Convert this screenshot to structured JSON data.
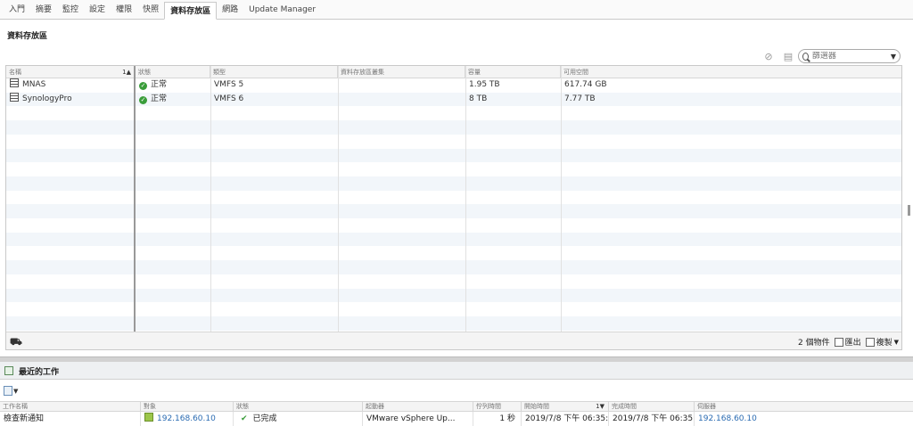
{
  "tabs": [
    "入門",
    "摘要",
    "監控",
    "設定",
    "權限",
    "快照",
    "資料存放區",
    "網路",
    "Update Manager"
  ],
  "active_tab_index": 6,
  "section_title": "資料存放區",
  "filter": {
    "placeholder": "篩選器"
  },
  "datastore_table": {
    "columns": [
      "名稱",
      "狀態",
      "類型",
      "資料存放區叢集",
      "容量",
      "可用空間"
    ],
    "sort_indicator": "1▲",
    "rows": [
      {
        "name": "MNAS",
        "status": "正常",
        "type": "VMFS 5",
        "cluster": "",
        "capacity": "1.95  TB",
        "free": "617.74  GB"
      },
      {
        "name": "SynologyPro",
        "status": "正常",
        "type": "VMFS 6",
        "cluster": "",
        "capacity": "8  TB",
        "free": "7.77  TB"
      }
    ],
    "footer": {
      "count": "2 個物件",
      "export_label": "匯出",
      "copy_label": "複製"
    }
  },
  "recent_tasks": {
    "title": "最近的工作",
    "columns": [
      "工作名稱",
      "對象",
      "狀態",
      "起動器",
      "佇列時間",
      "開始時間",
      "完成時間",
      "伺服器"
    ],
    "start_sort": "1▼",
    "rows": [
      {
        "name": "檢查新通知",
        "target": "192.168.60.10",
        "status": "已完成",
        "initiator": "VMware vSphere Up...",
        "queue_time": "1 秒",
        "start_time": "2019/7/8 下午 06:35:...",
        "complete_time": "2019/7/8 下午 06:35:...",
        "server": "192.168.60.10"
      }
    ]
  },
  "colors": {
    "accent_link": "#2a6bb2",
    "ok_green": "#3a9d3a",
    "row_alt": "#f2f6fa"
  }
}
